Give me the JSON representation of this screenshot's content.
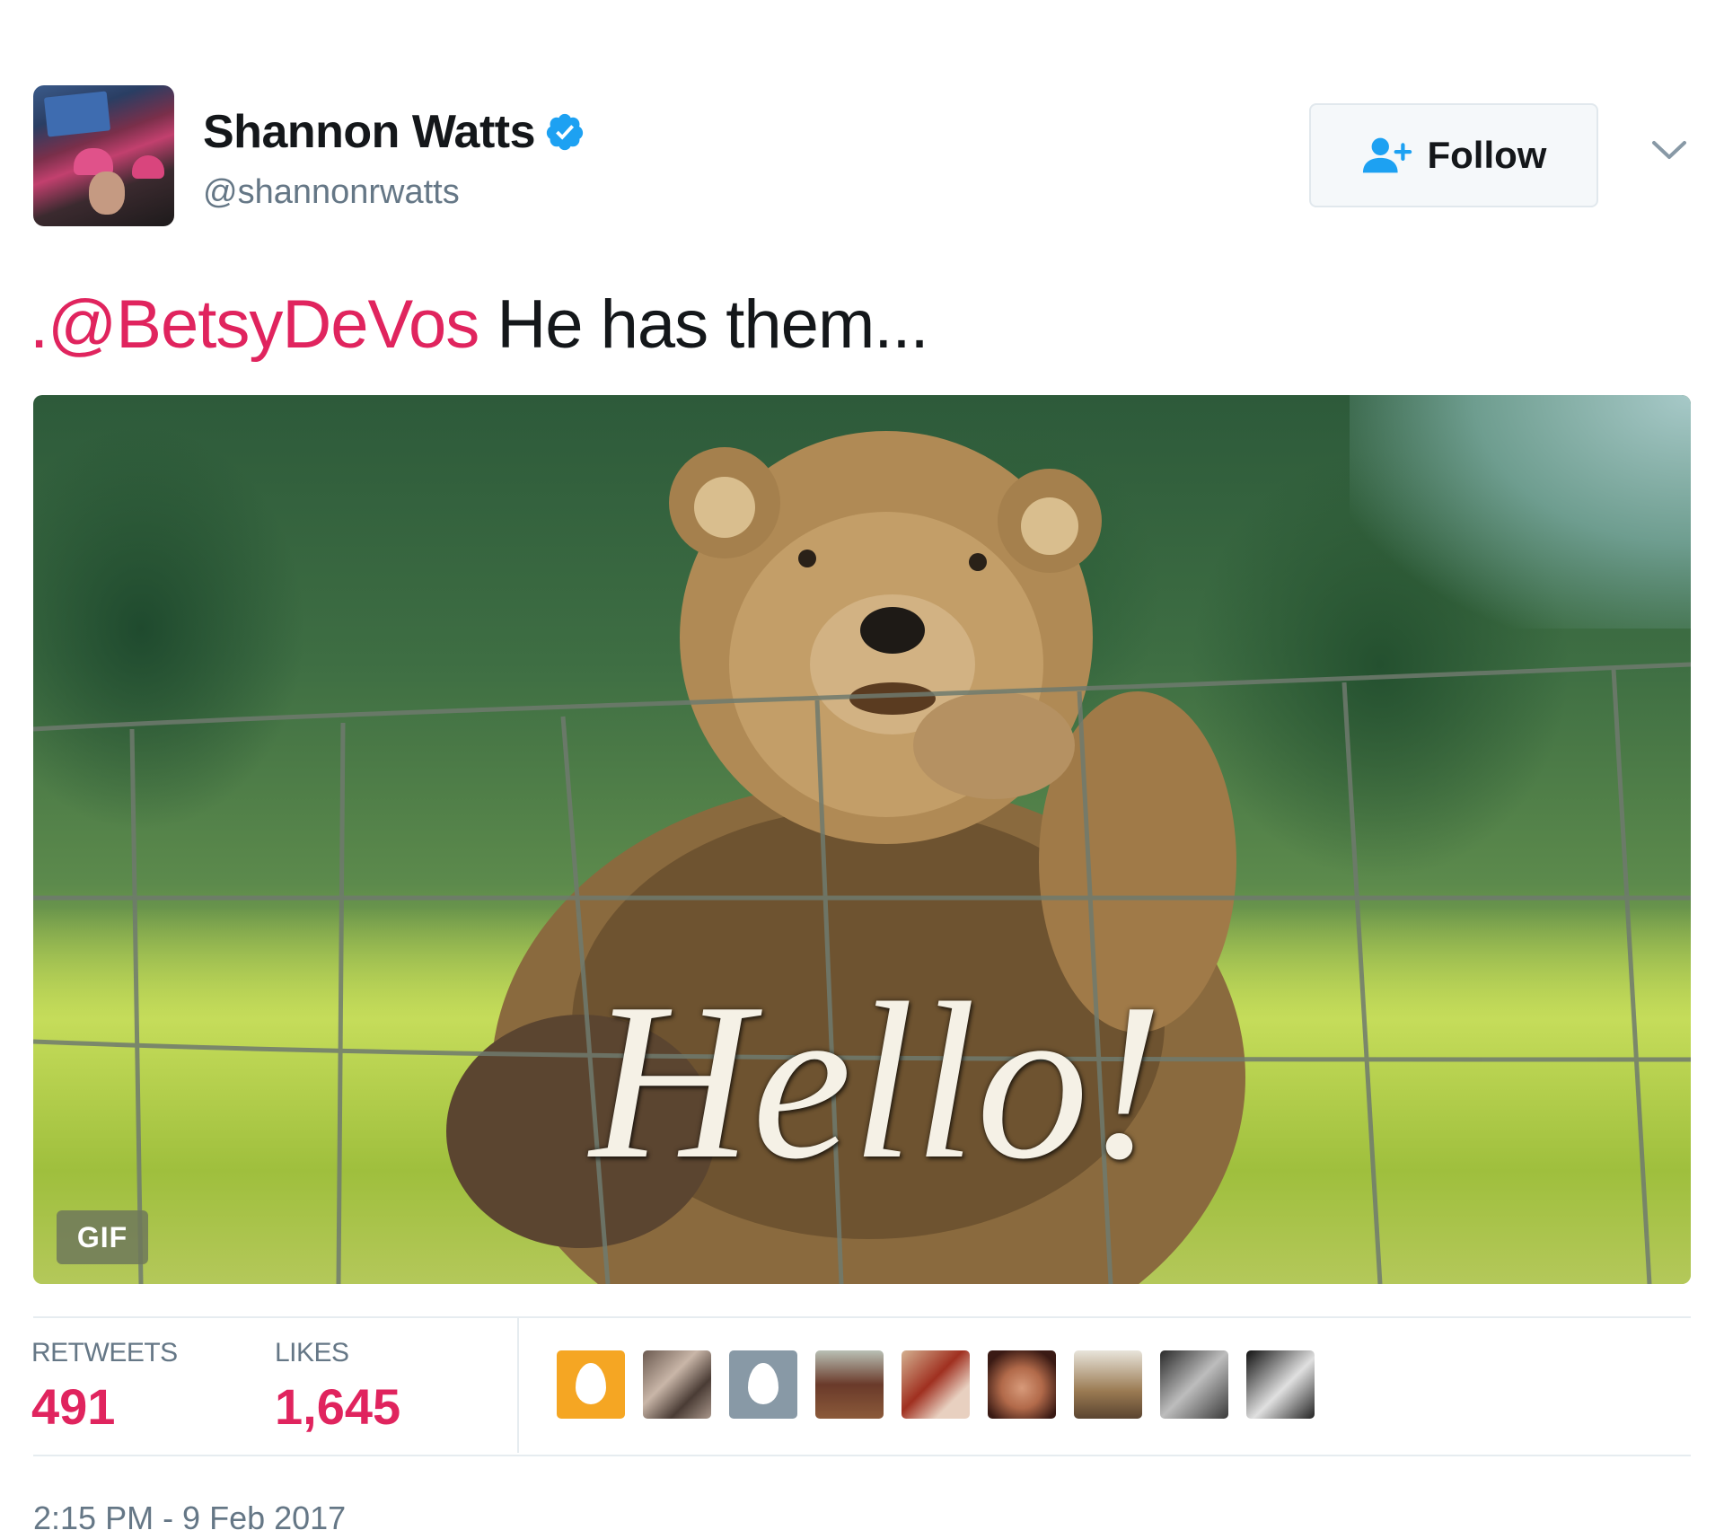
{
  "user": {
    "display_name": "Shannon Watts",
    "handle": "@shannonrwatts",
    "verified": true
  },
  "follow_button": {
    "label": "Follow"
  },
  "tweet": {
    "mention": ".@BetsyDeVos",
    "text": " He has them..."
  },
  "media": {
    "overlay_text": "Hello!",
    "badge": "GIF"
  },
  "stats": {
    "retweets_label": "RETWEETS",
    "retweets_count": "491",
    "likes_label": "LIKES",
    "likes_count": "1,645"
  },
  "timestamp": "2:15 PM - 9 Feb 2017",
  "colors": {
    "accent": "#e0245e",
    "verified": "#1da1f2",
    "muted": "#657786"
  },
  "icons": [
    "verified-icon",
    "follow-person-icon",
    "chevron-down-icon"
  ]
}
